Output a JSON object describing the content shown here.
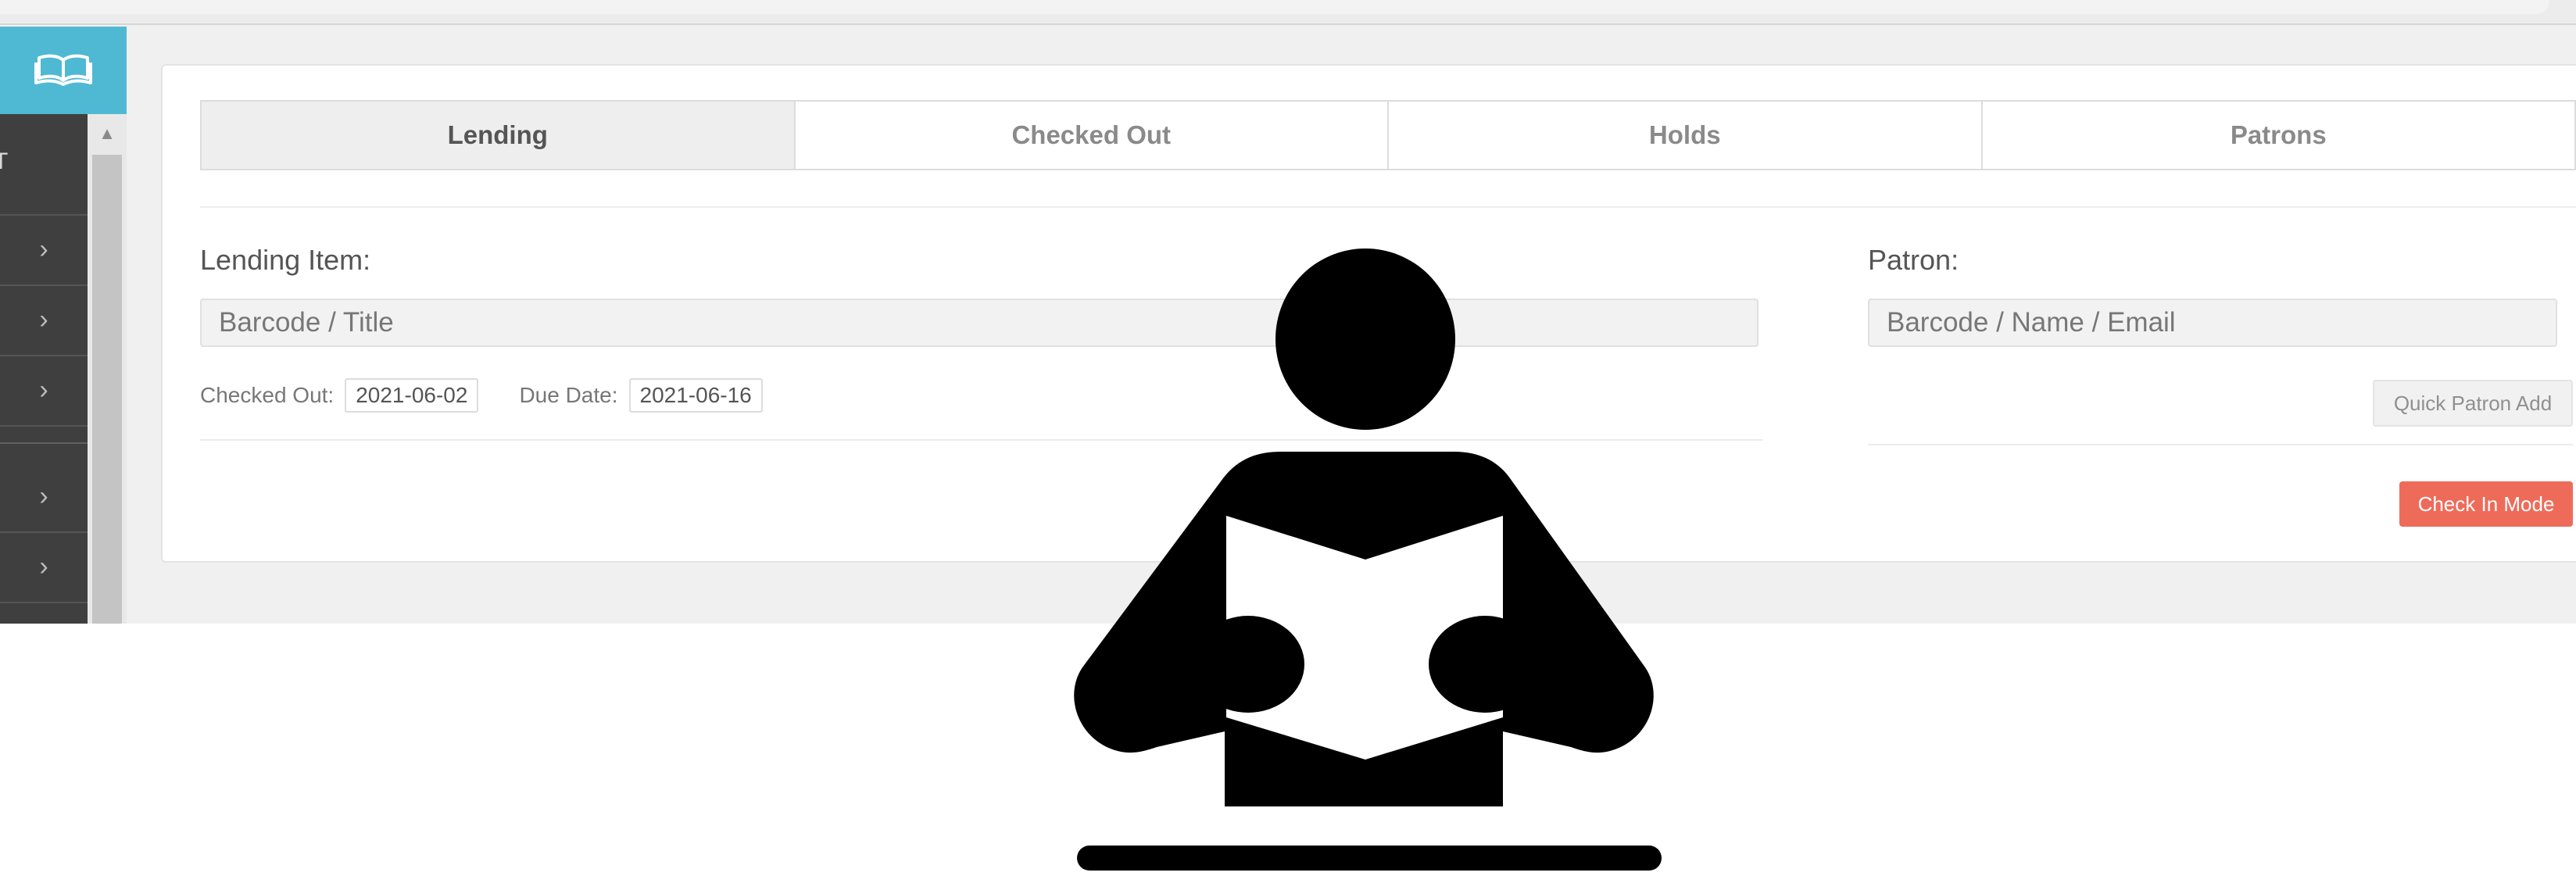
{
  "colors": {
    "sidebar_logo_bg": "#4fb9d3",
    "sidebar_bg": "#3f3f3f",
    "check_in_button": "#ee6b5a",
    "active_tab_bg": "#eeeeee"
  },
  "sidebar": {
    "logo_icon": "open-book-icon",
    "header_fragment": "T",
    "items": [
      {
        "icon": "chevron-right-icon",
        "glyph": "›"
      },
      {
        "icon": "chevron-right-icon",
        "glyph": "›"
      },
      {
        "icon": "chevron-right-icon",
        "glyph": "›"
      },
      {
        "icon": "chevron-right-icon",
        "glyph": "›"
      },
      {
        "icon": "chevron-right-icon",
        "glyph": "›"
      }
    ],
    "scroll_up_glyph": "▲"
  },
  "tabs": [
    {
      "label": "Lending",
      "active": true
    },
    {
      "label": "Checked Out",
      "active": false
    },
    {
      "label": "Holds",
      "active": false
    },
    {
      "label": "Patrons",
      "active": false
    }
  ],
  "lending": {
    "label": "Lending Item:",
    "placeholder": "Barcode / Title",
    "checked_out_label": "Checked Out:",
    "checked_out_value": "2021-06-02",
    "due_date_label": "Due Date:",
    "due_date_value": "2021-06-16"
  },
  "patron": {
    "label": "Patron:",
    "placeholder": "Barcode / Name / Email",
    "quick_add_label": "Quick Patron Add",
    "check_in_label": "Check In Mode"
  },
  "overlay": {
    "icon": "person-reading-icon"
  }
}
